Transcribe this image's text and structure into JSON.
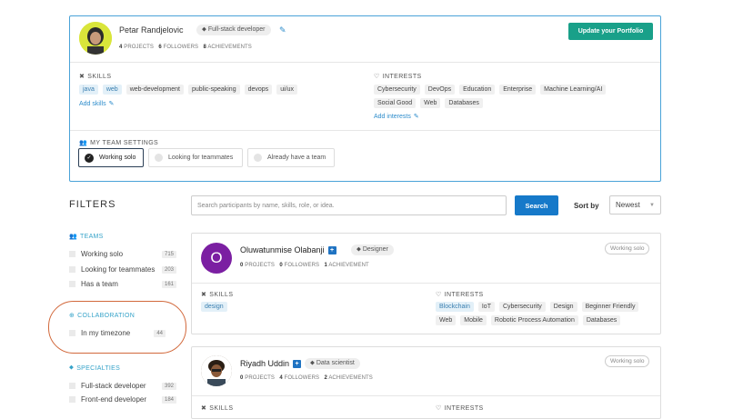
{
  "profile": {
    "name": "Petar Randjelovic",
    "role": "Full-stack developer",
    "projects": "4",
    "projects_label": "PROJECTS",
    "followers": "6",
    "followers_label": "FOLLOWERS",
    "achievements": "8",
    "achievements_label": "ACHIEVEMENTS",
    "update_button": "Update your Portfolio",
    "skills_label": "SKILLS",
    "skills": [
      "java",
      "web",
      "web-development",
      "public-speaking",
      "devops",
      "ui/ux"
    ],
    "add_skills": "Add skills",
    "interests_label": "INTERESTS",
    "interests": [
      "Cybersecurity",
      "DevOps",
      "Education",
      "Enterprise",
      "Machine Learning/AI",
      "Social Good",
      "Web",
      "Databases"
    ],
    "add_interests": "Add interests",
    "team_settings_label": "MY TEAM SETTINGS",
    "team_options": [
      "Working solo",
      "Looking for teammates",
      "Already have a team"
    ]
  },
  "filters": {
    "title": "FILTERS",
    "search_placeholder": "Search participants by name, skills, role, or idea.",
    "search_button": "Search",
    "sort_by_label": "Sort by",
    "sort_value": "Newest",
    "teams": {
      "head": "TEAMS",
      "items": [
        {
          "label": "Working solo",
          "count": "715"
        },
        {
          "label": "Looking for teammates",
          "count": "203"
        },
        {
          "label": "Has a team",
          "count": "161"
        }
      ]
    },
    "collaboration": {
      "head": "COLLABORATION",
      "items": [
        {
          "label": "In my timezone",
          "count": "44"
        }
      ]
    },
    "specialties": {
      "head": "SPECIALTIES",
      "items": [
        {
          "label": "Full-stack developer",
          "count": "392"
        },
        {
          "label": "Front-end developer",
          "count": "184"
        }
      ]
    }
  },
  "participants": [
    {
      "initial": "O",
      "name": "Oluwatunmise Olabanji",
      "role": "Designer",
      "status": "Working solo",
      "projects": "0",
      "projects_label": "PROJECTS",
      "followers": "0",
      "followers_label": "FOLLOWERS",
      "achievements": "1",
      "achievements_label": "ACHIEVEMENT",
      "skills_label": "SKILLS",
      "skills": [
        "design"
      ],
      "interests_label": "INTERESTS",
      "interests": [
        "Blockchain",
        "IoT",
        "Cybersecurity",
        "Design",
        "Beginner Friendly",
        "Web",
        "Mobile",
        "Robotic Process Automation",
        "Databases"
      ]
    },
    {
      "name": "Riyadh Uddin",
      "role": "Data scientist",
      "status": "Working solo",
      "projects": "0",
      "projects_label": "PROJECTS",
      "followers": "4",
      "followers_label": "FOLLOWERS",
      "achievements": "2",
      "achievements_label": "ACHIEVEMENTS",
      "skills_label": "SKILLS",
      "interests_label": "INTERESTS"
    }
  ],
  "colors": {
    "accent_blue": "#1679c9",
    "update_green": "#19a089",
    "filter_head": "#36a3c9",
    "highlight": "#d2693c",
    "avatar_purple": "#7b1fa2"
  }
}
